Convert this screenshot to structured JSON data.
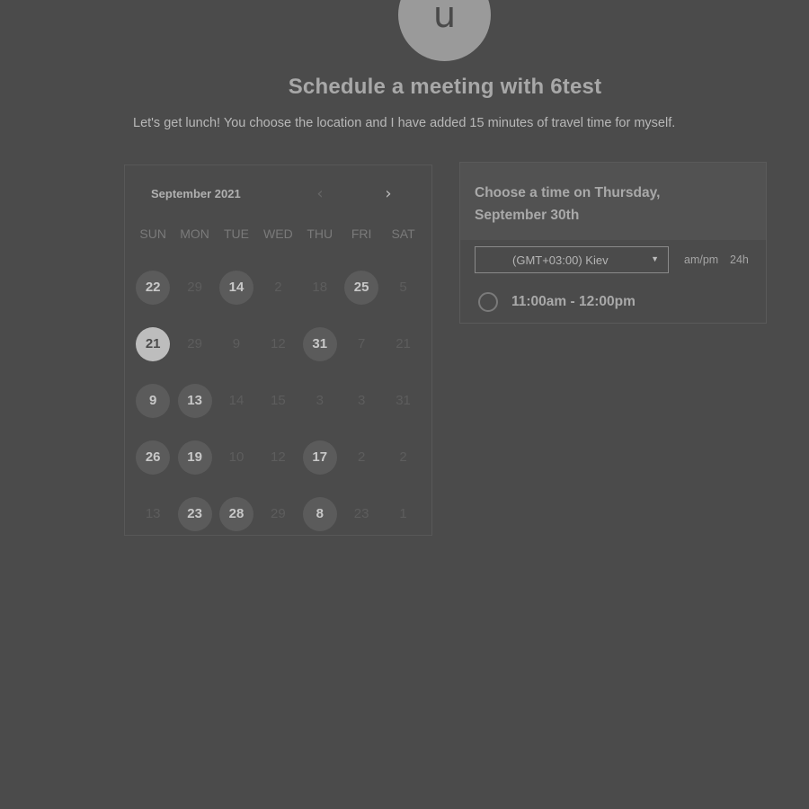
{
  "avatar": {
    "initial": "u"
  },
  "title": "Schedule a meeting with 6test",
  "description": "Let's get lunch! You choose the location and I have added 15 minutes of travel time for myself.",
  "calendar": {
    "month_label": "September 2021",
    "prev_icon": "‹",
    "next_icon": "›",
    "weekdays": [
      "SUN",
      "MON",
      "TUE",
      "WED",
      "THU",
      "FRI",
      "SAT"
    ],
    "weeks": [
      [
        {
          "label": "22",
          "state": "available"
        },
        {
          "label": "29",
          "state": "inactive"
        },
        {
          "label": "14",
          "state": "available"
        },
        {
          "label": "2",
          "state": "inactive"
        },
        {
          "label": "18",
          "state": "inactive"
        },
        {
          "label": "25",
          "state": "available"
        },
        {
          "label": "5",
          "state": "inactive"
        }
      ],
      [
        {
          "label": "21",
          "state": "selected"
        },
        {
          "label": "29",
          "state": "inactive"
        },
        {
          "label": "9",
          "state": "inactive"
        },
        {
          "label": "12",
          "state": "inactive"
        },
        {
          "label": "31",
          "state": "available"
        },
        {
          "label": "7",
          "state": "inactive"
        },
        {
          "label": "21",
          "state": "inactive"
        }
      ],
      [
        {
          "label": "9",
          "state": "available"
        },
        {
          "label": "13",
          "state": "available"
        },
        {
          "label": "14",
          "state": "inactive"
        },
        {
          "label": "15",
          "state": "inactive"
        },
        {
          "label": "3",
          "state": "inactive"
        },
        {
          "label": "3",
          "state": "inactive"
        },
        {
          "label": "31",
          "state": "inactive"
        }
      ],
      [
        {
          "label": "26",
          "state": "available"
        },
        {
          "label": "19",
          "state": "available"
        },
        {
          "label": "10",
          "state": "inactive"
        },
        {
          "label": "12",
          "state": "inactive"
        },
        {
          "label": "17",
          "state": "available"
        },
        {
          "label": "2",
          "state": "inactive"
        },
        {
          "label": "2",
          "state": "inactive"
        }
      ],
      [
        {
          "label": "13",
          "state": "inactive"
        },
        {
          "label": "23",
          "state": "available"
        },
        {
          "label": "28",
          "state": "available"
        },
        {
          "label": "29",
          "state": "inactive"
        },
        {
          "label": "8",
          "state": "available"
        },
        {
          "label": "23",
          "state": "inactive"
        },
        {
          "label": "1",
          "state": "inactive"
        }
      ]
    ]
  },
  "time_panel": {
    "title": "Choose a time on Thursday, September 30th",
    "timezone": "(GMT+03:00) Kiev",
    "format_ampm": "am/pm",
    "format_24": "24h",
    "slots": [
      {
        "label": "11:00am - 12:00pm"
      }
    ]
  }
}
